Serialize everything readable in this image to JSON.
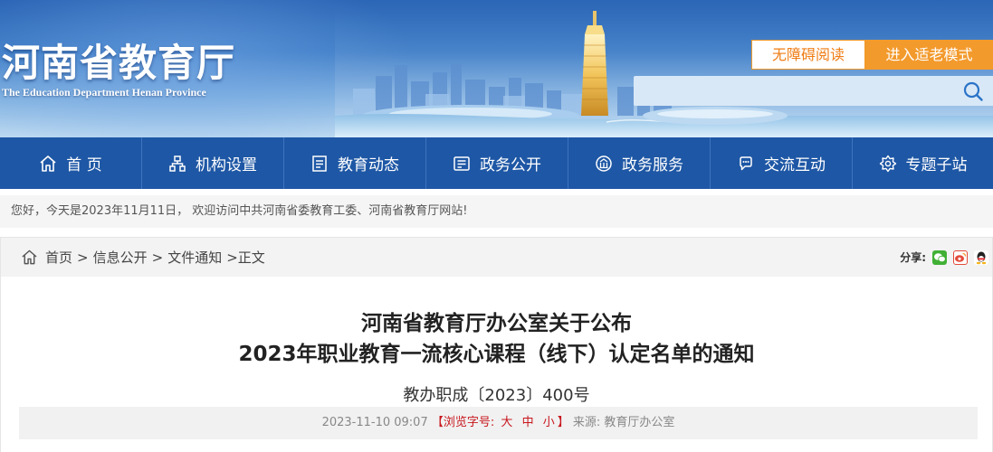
{
  "header": {
    "site_title": "河南省教育厅",
    "site_subtitle": "The Education Department Henan Province",
    "accessible_label": "无障碍阅读",
    "elder_mode_label": "进入适老模式",
    "search": {
      "value": "",
      "placeholder": ""
    }
  },
  "nav": {
    "items": [
      {
        "label": "首 页",
        "icon": "home-icon"
      },
      {
        "label": "机构设置",
        "icon": "org-chart-icon"
      },
      {
        "label": "教育动态",
        "icon": "news-list-icon"
      },
      {
        "label": "政务公开",
        "icon": "document-icon"
      },
      {
        "label": "政务服务",
        "icon": "service-emblem-icon"
      },
      {
        "label": "交流互动",
        "icon": "chat-icon"
      },
      {
        "label": "专题子站",
        "icon": "topic-gear-icon"
      }
    ]
  },
  "welcome": {
    "text": "您好，今天是2023年11月11日， 欢迎访问中共河南省委教育工委、河南省教育厅网站!"
  },
  "breadcrumb": {
    "items": [
      "首页",
      "信息公开",
      "文件通知"
    ],
    "current": "正文",
    "current_prefix": ">"
  },
  "share": {
    "label": "分享:",
    "icons": [
      "wechat-icon",
      "weibo-icon",
      "qq-icon"
    ]
  },
  "article": {
    "title_line1": "河南省教育厅办公室关于公布",
    "title_line2": "2023年职业教育一流核心课程（线下）认定名单的通知",
    "doc_number": "教办职成〔2023〕400号",
    "date": "2023-11-10 09:07",
    "font_size_label": "【浏览字号:",
    "font_sizes": [
      "大",
      "中",
      "小"
    ],
    "font_size_close": "】",
    "source": "来源: 教育厅办公室"
  },
  "colors": {
    "nav_bg": "#1e57a5",
    "accent_orange": "#f39a2c",
    "font_size_red": "#c8161d"
  }
}
